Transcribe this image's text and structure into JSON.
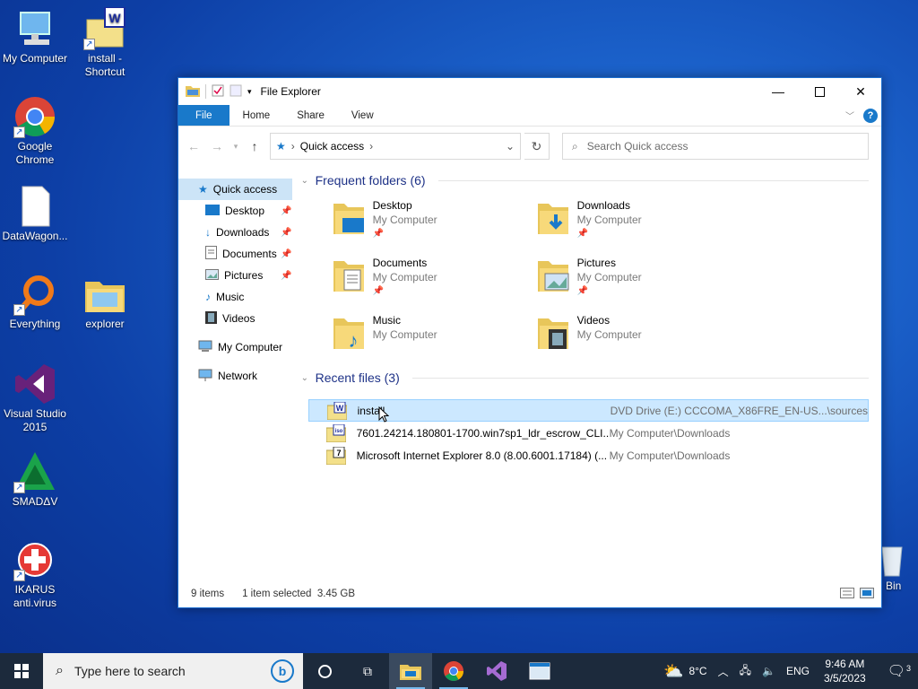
{
  "desktop": {
    "icons": [
      {
        "label": "My Computer"
      },
      {
        "label": "install - Shortcut"
      },
      {
        "label": "Google Chrome"
      },
      {
        "label": "DataWagon..."
      },
      {
        "label": "Everything"
      },
      {
        "label": "explorer"
      },
      {
        "label": "Visual Studio 2015"
      },
      {
        "label": "SMADΔV"
      },
      {
        "label": "IKARUS anti.virus"
      },
      {
        "label": "Bin"
      }
    ]
  },
  "window": {
    "title": "File Explorer",
    "ribbon_tabs": [
      "File",
      "Home",
      "Share",
      "View"
    ],
    "help": "?",
    "address": "Quick access",
    "search_placeholder": "Search Quick access"
  },
  "navpane": {
    "quick_access": "Quick access",
    "items": [
      {
        "label": "Desktop",
        "pinned": true
      },
      {
        "label": "Downloads",
        "pinned": true
      },
      {
        "label": "Documents",
        "pinned": true
      },
      {
        "label": "Pictures",
        "pinned": true
      },
      {
        "label": "Music",
        "pinned": false
      },
      {
        "label": "Videos",
        "pinned": false
      }
    ],
    "my_computer": "My Computer",
    "network": "Network"
  },
  "frequent": {
    "header": "Frequent folders (6)",
    "folders": [
      {
        "name": "Desktop",
        "location": "My Computer",
        "icon": "desktop-folder-icon"
      },
      {
        "name": "Downloads",
        "location": "My Computer",
        "icon": "downloads-folder-icon"
      },
      {
        "name": "Documents",
        "location": "My Computer",
        "icon": "documents-folder-icon"
      },
      {
        "name": "Pictures",
        "location": "My Computer",
        "icon": "pictures-folder-icon"
      },
      {
        "name": "Music",
        "location": "My Computer",
        "icon": "music-folder-icon"
      },
      {
        "name": "Videos",
        "location": "My Computer",
        "icon": "videos-folder-icon"
      }
    ]
  },
  "recent": {
    "header": "Recent files (3)",
    "files": [
      {
        "name": "install",
        "path": "DVD Drive (E:) CCCOMA_X86FRE_EN-US...\\sources",
        "badge": "W"
      },
      {
        "name": "7601.24214.180801-1700.win7sp1_ldr_escrow_CLI...",
        "path": "My Computer\\Downloads",
        "badge": "iso"
      },
      {
        "name": "Microsoft Internet Explorer 8.0 (8.00.6001.17184) (...",
        "path": "My Computer\\Downloads",
        "badge": "7"
      }
    ]
  },
  "status": {
    "items": "9 items",
    "selected": "1 item selected  3.45 GB"
  },
  "taskbar": {
    "search_placeholder": "Type here to search",
    "weather": "8°C",
    "language": "ENG",
    "time": "9:46 AM",
    "date": "3/5/2023",
    "notifications": "3"
  },
  "colors": {
    "accent": "#1979ca",
    "selection": "#cce8ff",
    "header_text": "#1e3287"
  }
}
